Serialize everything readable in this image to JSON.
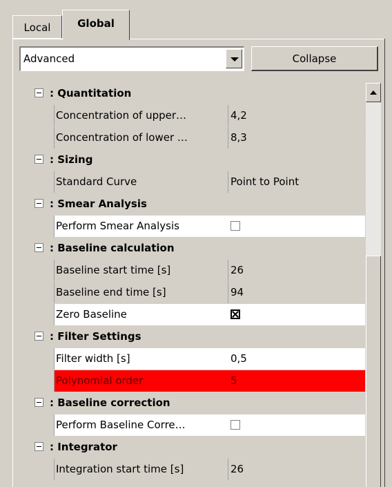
{
  "tabs": {
    "local": "Local",
    "global": "Global",
    "active": "Global"
  },
  "toolbar": {
    "mode_value": "Advanced",
    "collapse_label": "Collapse"
  },
  "sections": [
    {
      "title": ": Quantitation",
      "rows": [
        {
          "name": "Concentration of upper…",
          "value": "4,2",
          "type": "text"
        },
        {
          "name": "Concentration of lower …",
          "value": "8,3",
          "type": "text"
        }
      ]
    },
    {
      "title": ": Sizing",
      "rows": [
        {
          "name": "Standard Curve",
          "value": "Point to Point",
          "type": "text"
        }
      ]
    },
    {
      "title": ": Smear Analysis",
      "rows": [
        {
          "name": "Perform Smear Analysis",
          "value": "unchecked",
          "type": "checkbox"
        }
      ]
    },
    {
      "title": ": Baseline calculation",
      "rows": [
        {
          "name": "Baseline start time [s]",
          "value": "26",
          "type": "text"
        },
        {
          "name": "Baseline end time [s]",
          "value": "94",
          "type": "text"
        },
        {
          "name": "Zero Baseline",
          "value": "checked",
          "type": "checkbox"
        }
      ]
    },
    {
      "title": ": Filter Settings",
      "rows": [
        {
          "name": "Filter width [s]",
          "value": "0,5",
          "type": "text"
        },
        {
          "name": "Polynomial order",
          "value": "5",
          "type": "text",
          "state": "error"
        }
      ]
    },
    {
      "title": ": Baseline correction",
      "rows": [
        {
          "name": "Perform Baseline Corre…",
          "value": "unchecked",
          "type": "checkbox"
        }
      ]
    },
    {
      "title": ": Integrator",
      "rows": [
        {
          "name": "Integration start time [s]",
          "value": "26",
          "type": "text"
        }
      ]
    }
  ],
  "colors": {
    "window_bg": "#d4d0c8",
    "error_bg": "#ff0000"
  },
  "icons": {
    "section_toggle": "minus-box-icon",
    "dropdown": "chevron-down-icon",
    "scroll_up": "arrow-up-icon"
  }
}
